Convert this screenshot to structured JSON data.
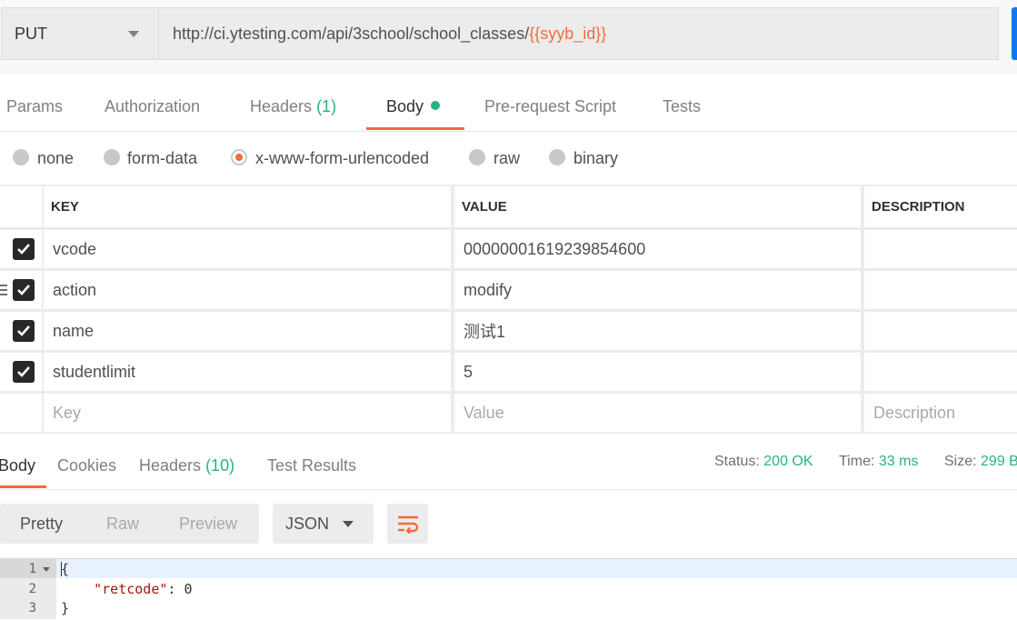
{
  "request": {
    "method": "PUT",
    "url_prefix": "http://ci.ytesting.com/api/3school/school_classes/",
    "url_variable": "{{syyb_id}}"
  },
  "request_tabs": [
    {
      "label": "Params"
    },
    {
      "label": "Authorization"
    },
    {
      "label": "Headers",
      "count": "(1)"
    },
    {
      "label": "Body"
    },
    {
      "label": "Pre-request Script"
    },
    {
      "label": "Tests"
    }
  ],
  "body_types": [
    {
      "label": "none",
      "selected": false
    },
    {
      "label": "form-data",
      "selected": false
    },
    {
      "label": "x-www-form-urlencoded",
      "selected": true
    },
    {
      "label": "raw",
      "selected": false
    },
    {
      "label": "binary",
      "selected": false
    }
  ],
  "params_table": {
    "headers": [
      "KEY",
      "VALUE",
      "DESCRIPTION"
    ],
    "rows": [
      {
        "key": "vcode",
        "value": "00000001619239854600",
        "checked": true
      },
      {
        "key": "action",
        "value": "modify",
        "checked": true
      },
      {
        "key": "name",
        "value": "测试1",
        "checked": true
      },
      {
        "key": "studentlimit",
        "value": "5",
        "checked": true
      }
    ],
    "placeholders": {
      "key": "Key",
      "value": "Value",
      "description": "Description"
    }
  },
  "response_tabs": [
    {
      "label": "Body"
    },
    {
      "label": "Cookies"
    },
    {
      "label": "Headers",
      "count": "(10)"
    },
    {
      "label": "Test Results"
    }
  ],
  "response_status": {
    "status_label": "Status:",
    "status_value": "200 OK",
    "time_label": "Time:",
    "time_value": "33 ms",
    "size_label": "Size:",
    "size_value": "299 B"
  },
  "view_modes": [
    "Pretty",
    "Raw",
    "Preview"
  ],
  "format": "JSON",
  "code_lines": [
    {
      "num": "1",
      "text": "{"
    },
    {
      "num": "2",
      "key": "\"retcode\"",
      "rest": ": 0"
    },
    {
      "num": "3",
      "text": "}"
    }
  ],
  "icons": {
    "wrap": "text-wrap-icon",
    "check": "check-icon",
    "caret": "chevron-down-icon"
  },
  "colors": {
    "accent": "#f26b3a",
    "success": "#26b47f",
    "send": "#097bed"
  }
}
